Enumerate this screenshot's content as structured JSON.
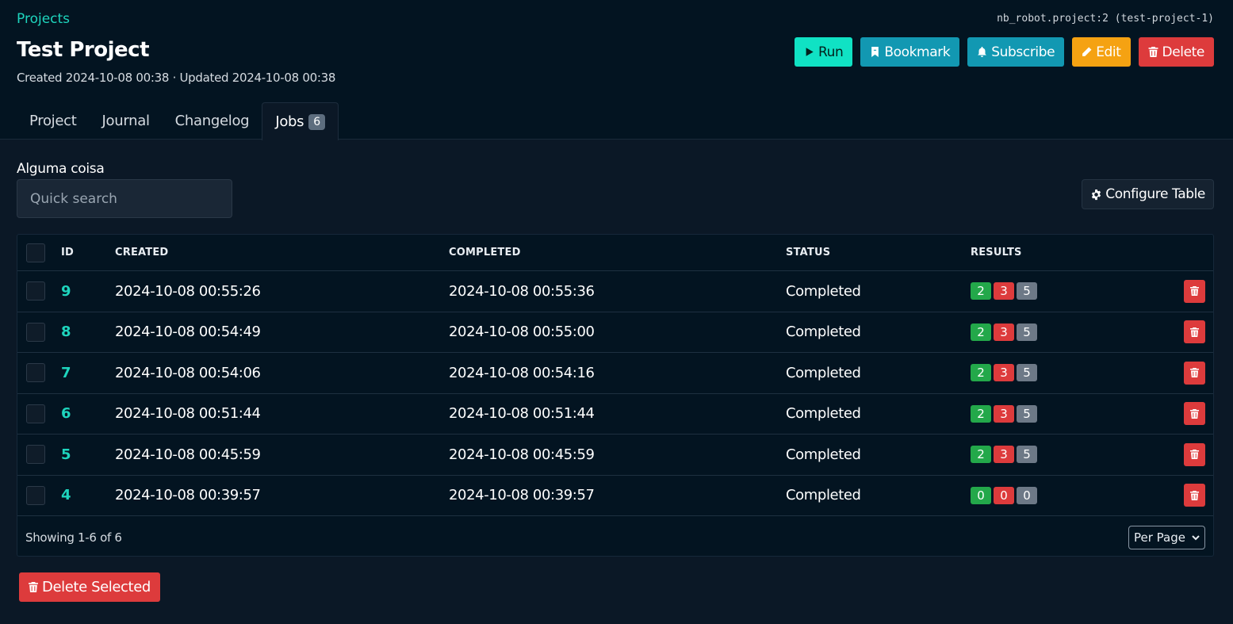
{
  "breadcrumb": "Projects",
  "object_id": "nb_robot.project:2 (test-project-1)",
  "title": "Test Project",
  "meta": "Created 2024-10-08 00:38 · Updated 2024-10-08 00:38",
  "actions": {
    "run": "Run",
    "bookmark": "Bookmark",
    "subscribe": "Subscribe",
    "edit": "Edit",
    "delete": "Delete"
  },
  "tabs": [
    {
      "label": "Project"
    },
    {
      "label": "Journal"
    },
    {
      "label": "Changelog"
    },
    {
      "label": "Jobs",
      "badge": "6",
      "active": true
    }
  ],
  "filter": {
    "label": "Alguma coisa",
    "placeholder": "Quick search"
  },
  "configure_table": "Configure Table",
  "table": {
    "columns": [
      "ID",
      "CREATED",
      "COMPLETED",
      "STATUS",
      "RESULTS"
    ],
    "rows": [
      {
        "id": "9",
        "created": "2024-10-08 00:55:26",
        "completed": "2024-10-08 00:55:36",
        "status": "Completed",
        "results": [
          "2",
          "3",
          "5"
        ]
      },
      {
        "id": "8",
        "created": "2024-10-08 00:54:49",
        "completed": "2024-10-08 00:55:00",
        "status": "Completed",
        "results": [
          "2",
          "3",
          "5"
        ]
      },
      {
        "id": "7",
        "created": "2024-10-08 00:54:06",
        "completed": "2024-10-08 00:54:16",
        "status": "Completed",
        "results": [
          "2",
          "3",
          "5"
        ]
      },
      {
        "id": "6",
        "created": "2024-10-08 00:51:44",
        "completed": "2024-10-08 00:51:44",
        "status": "Completed",
        "results": [
          "2",
          "3",
          "5"
        ]
      },
      {
        "id": "5",
        "created": "2024-10-08 00:45:59",
        "completed": "2024-10-08 00:45:59",
        "status": "Completed",
        "results": [
          "2",
          "3",
          "5"
        ]
      },
      {
        "id": "4",
        "created": "2024-10-08 00:39:57",
        "completed": "2024-10-08 00:39:57",
        "status": "Completed",
        "results": [
          "0",
          "0",
          "0"
        ]
      }
    ]
  },
  "pagination": {
    "showing": "Showing 1-6 of 6",
    "per_page": "Per Page"
  },
  "delete_selected": "Delete Selected",
  "colors": {
    "accent": "#1ed4bd",
    "pass": "#23a84a",
    "fail": "#dd3b3c",
    "skip": "#6d7987"
  }
}
